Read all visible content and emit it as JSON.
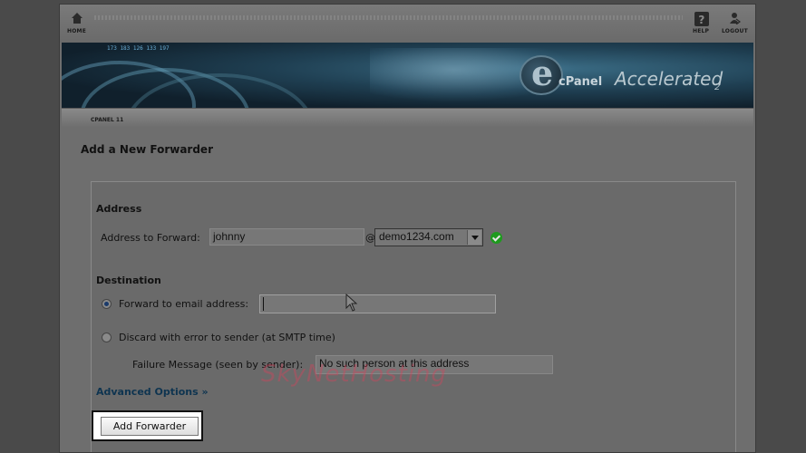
{
  "topnav": {
    "home_label": "HOME",
    "help_label": "HELP",
    "logout_label": "LOGOUT"
  },
  "banner": {
    "numbers_line": "173 183 126 133 197",
    "logo_text": "cPanel",
    "logo_accelerated": "Accelerated",
    "logo_version": "2"
  },
  "breadcrumb": "CPANEL 11",
  "page": {
    "title": "Add a New Forwarder"
  },
  "address_section": {
    "heading": "Address",
    "address_label": "Address to Forward:",
    "address_value": "johnny",
    "at_sign": "@",
    "domain_selected": "demo1234.com"
  },
  "destination_section": {
    "heading": "Destination",
    "forward_label": "Forward to email address:",
    "forward_value": "",
    "discard_label": "Discard with error to sender (at SMTP time)",
    "failure_label": "Failure Message (seen by sender):",
    "failure_value": "No such person at this address"
  },
  "advanced_options_label": "Advanced Options »",
  "submit_label": "Add Forwarder",
  "watermark_text": "SkyNetHosting",
  "colors": {
    "success_check": "#1e9a1e",
    "advanced_link": "#0e3450",
    "watermark": "#e63c5a"
  }
}
